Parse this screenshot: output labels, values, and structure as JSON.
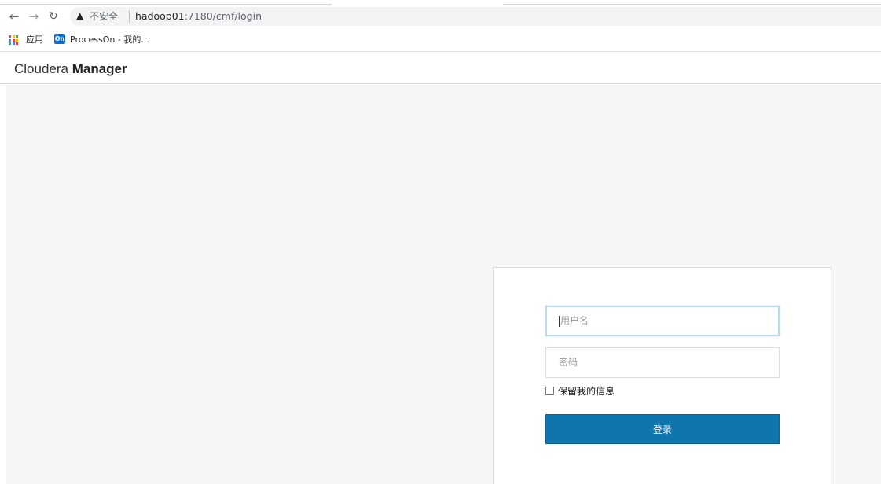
{
  "browser": {
    "url_host": "hadoop01",
    "url_rest": ":7180/cmf/login",
    "security_label": "不安全",
    "icons": {
      "back": "arrow-left-icon",
      "forward": "arrow-right-icon",
      "reload": "reload-icon",
      "security": "warning-triangle-icon"
    }
  },
  "bookmarks": {
    "items": [
      {
        "label": "应用",
        "icon": "apps-grid-icon"
      },
      {
        "label": "ProcessOn - 我的...",
        "icon": "processon-icon",
        "icon_text": "On"
      }
    ]
  },
  "app": {
    "brand_light": "Cloudera ",
    "brand_bold": "Manager"
  },
  "login": {
    "username_placeholder": "用户名",
    "password_placeholder": "密码",
    "remember_label": "保留我的信息",
    "remember_checked": false,
    "submit_label": "登录"
  },
  "colors": {
    "primary_button": "#0f75ad",
    "page_background": "#f5f6f8",
    "focus_border": "#bcdbe9"
  }
}
